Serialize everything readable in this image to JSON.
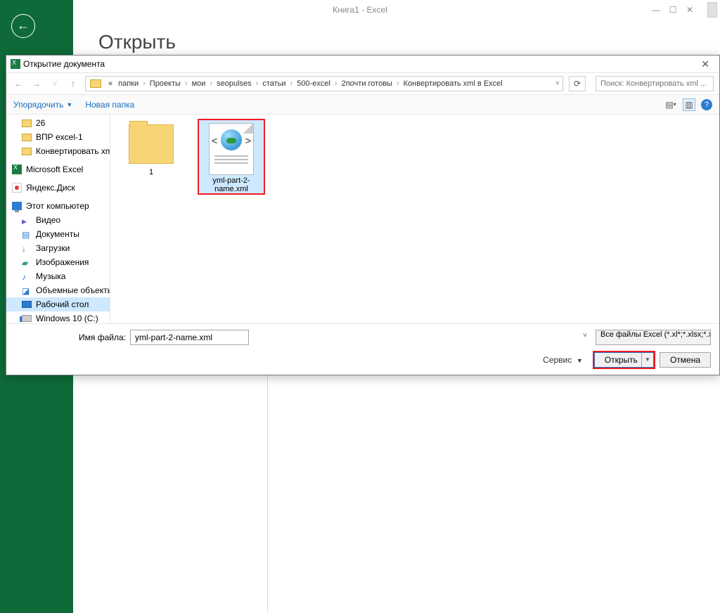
{
  "app": {
    "title": "Книга1 - Excel",
    "backstage_heading": "Открыть"
  },
  "dialog": {
    "title": "Открытие документа",
    "breadcrumb": {
      "prefix": "«",
      "segments": [
        "папки",
        "Проекты",
        "мои",
        "seopulses",
        "статьи",
        "500-excel",
        "2почти готовы",
        "Конвертировать xml в Excel"
      ]
    },
    "search_placeholder": "Поиск: Конвертировать xml ...",
    "toolbar": {
      "organize": "Упорядочить",
      "new_folder": "Новая папка"
    },
    "tree": [
      {
        "icon": "folder",
        "label": "26"
      },
      {
        "icon": "folder",
        "label": "ВПР excel-1"
      },
      {
        "icon": "folder",
        "label": "Конвертировать xml в Excel"
      },
      {
        "icon": "excel",
        "label": "Microsoft Excel"
      },
      {
        "icon": "ydisk",
        "label": "Яндекс.Диск"
      },
      {
        "icon": "pc",
        "label": "Этот компьютер"
      },
      {
        "icon": "video",
        "label": "Видео"
      },
      {
        "icon": "docs",
        "label": "Документы"
      },
      {
        "icon": "dl",
        "label": "Загрузки"
      },
      {
        "icon": "img",
        "label": "Изображения"
      },
      {
        "icon": "music",
        "label": "Музыка"
      },
      {
        "icon": "cube",
        "label": "Объемные объекты"
      },
      {
        "icon": "monitor",
        "label": "Рабочий стол",
        "selected": true
      },
      {
        "icon": "drive",
        "label": "Windows 10 (C:)"
      }
    ],
    "files": {
      "folder1_label": "1",
      "xml_label": "yml-part-2-name.xml"
    },
    "footer": {
      "filename_label": "Имя файла:",
      "filename_value": "yml-part-2-name.xml",
      "filter_label": "Все файлы Excel (*.xl*;*.xlsx;*.xlsm;...)",
      "tools_label": "Сервис",
      "open_label": "Открыть",
      "cancel_label": "Отмена"
    }
  }
}
